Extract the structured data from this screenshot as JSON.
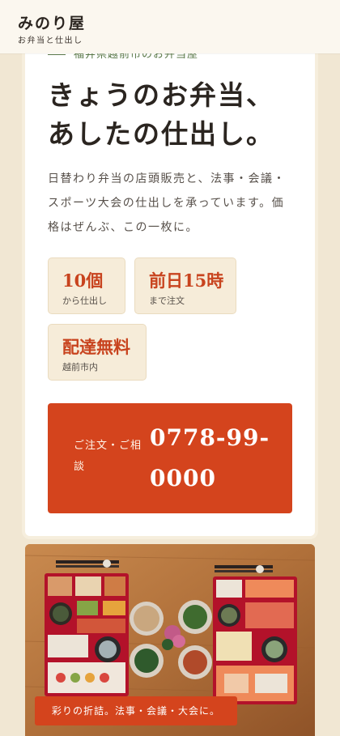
{
  "header": {
    "brand_name": "みのり屋",
    "brand_tagline": "お弁当と仕出し"
  },
  "hero": {
    "eyebrow": "福井県越前市のお弁当屋",
    "title_line1": "きょうのお弁当、",
    "title_line2": "あしたの仕出し。",
    "lead": "日替わり弁当の店頭販売と、法事・会議・スポーツ大会の仕出しを承っています。価格はぜんぶ、この一枚に。",
    "facts": [
      {
        "value": "10個",
        "label": "から仕出し"
      },
      {
        "value": "前日15時",
        "label": "まで注文"
      },
      {
        "value": "配達無料",
        "label": "越前市内"
      }
    ],
    "cta": {
      "label": "ご注文・ご相談",
      "phone": "0778-99-0000"
    }
  },
  "photo": {
    "caption": "彩りの折詰。法事・会議・大会に。"
  },
  "colors": {
    "accent": "#d4441d",
    "accent_text": "#c8431e",
    "eyebrow_green": "#5c7a4a",
    "page_bg": "#f1e7d3",
    "fact_bg": "#f6ecd9"
  }
}
